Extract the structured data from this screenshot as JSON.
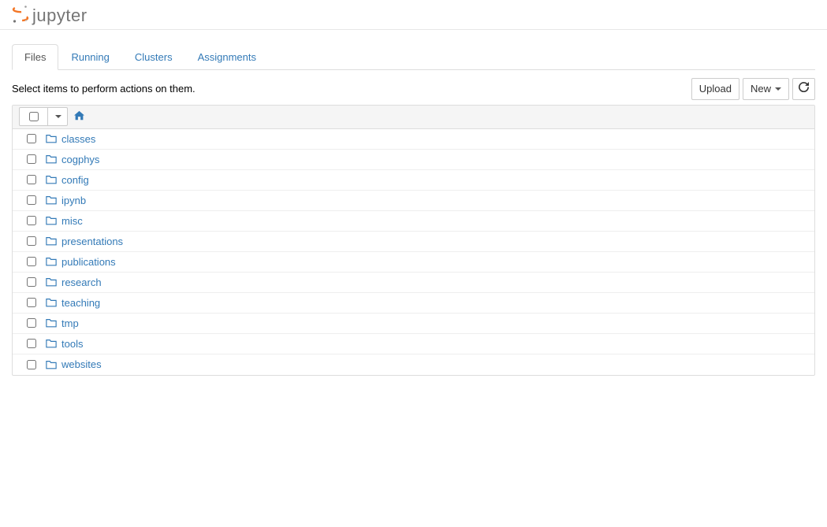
{
  "brand": {
    "name": "jupyter"
  },
  "tabs": [
    {
      "label": "Files",
      "active": true
    },
    {
      "label": "Running",
      "active": false
    },
    {
      "label": "Clusters",
      "active": false
    },
    {
      "label": "Assignments",
      "active": false
    }
  ],
  "toolbar": {
    "hint": "Select items to perform actions on them.",
    "upload": "Upload",
    "new": "New",
    "refresh_title": "Refresh"
  },
  "items": [
    {
      "name": "classes",
      "kind": "folder"
    },
    {
      "name": "cogphys",
      "kind": "folder"
    },
    {
      "name": "config",
      "kind": "folder"
    },
    {
      "name": "ipynb",
      "kind": "folder"
    },
    {
      "name": "misc",
      "kind": "folder"
    },
    {
      "name": "presentations",
      "kind": "folder"
    },
    {
      "name": "publications",
      "kind": "folder"
    },
    {
      "name": "research",
      "kind": "folder"
    },
    {
      "name": "teaching",
      "kind": "folder"
    },
    {
      "name": "tmp",
      "kind": "folder"
    },
    {
      "name": "tools",
      "kind": "folder"
    },
    {
      "name": "websites",
      "kind": "folder"
    }
  ]
}
